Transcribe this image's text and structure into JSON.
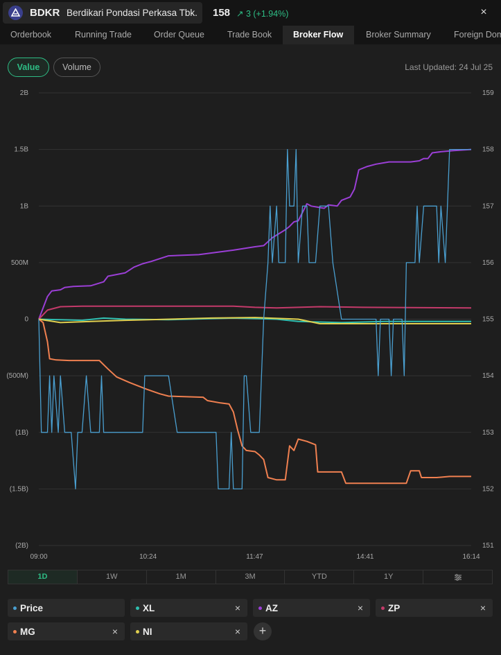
{
  "header": {
    "ticker": "BDKR",
    "company": "Berdikari Pondasi Perkasa Tbk.",
    "price": "158",
    "change": "3 (+1.94%)",
    "change_arrow": "↗",
    "close": "×"
  },
  "tabs": [
    "Orderbook",
    "Running Trade",
    "Order Queue",
    "Trade Book",
    "Broker Flow",
    "Broker Summary",
    "Foreign Dom"
  ],
  "active_tab": "Broker Flow",
  "toggles": {
    "value": "Value",
    "volume": "Volume"
  },
  "last_updated": "Last Updated: 24 Jul 25",
  "periods": [
    "1D",
    "1W",
    "1M",
    "3M",
    "YTD",
    "1Y"
  ],
  "active_period": "1D",
  "legend": {
    "price": "Price",
    "xl": "XL",
    "az": "AZ",
    "zp": "ZP",
    "mg": "MG",
    "ni": "NI",
    "remove": "×",
    "add": "+"
  },
  "colors": {
    "price": "#4a9fd0",
    "xl": "#2fbfb0",
    "az": "#9b3fd6",
    "zp": "#c43a6a",
    "mg": "#f08050",
    "ni": "#e0d050",
    "accent": "#2ebd85"
  },
  "icons": [
    "logo-icon",
    "close-icon",
    "arrow-up-right-icon",
    "filter-settings-icon",
    "plus-icon"
  ],
  "chart_data": {
    "type": "line",
    "x_ticks": [
      "09:00",
      "10:24",
      "11:47",
      "14:41",
      "16:14"
    ],
    "y_left_ticks": [
      "2B",
      "1.5B",
      "1B",
      "500M",
      "0",
      "(500M)",
      "(1B)",
      "(1.5B)",
      "(2B)"
    ],
    "y_right_ticks": [
      "159",
      "158",
      "157",
      "156",
      "155",
      "154",
      "153",
      "152",
      "151"
    ],
    "ylim_left": [
      -2000000000,
      2000000000
    ],
    "ylim_right": [
      151,
      159
    ],
    "grid": true,
    "series": [
      {
        "name": "AZ",
        "axis": "left",
        "color": "#9b3fd6",
        "points": [
          [
            0,
            0
          ],
          [
            0.02,
            200000000
          ],
          [
            0.03,
            250000000
          ],
          [
            0.05,
            260000000
          ],
          [
            0.06,
            280000000
          ],
          [
            0.08,
            290000000
          ],
          [
            0.12,
            295000000
          ],
          [
            0.15,
            330000000
          ],
          [
            0.16,
            380000000
          ],
          [
            0.2,
            410000000
          ],
          [
            0.22,
            460000000
          ],
          [
            0.24,
            490000000
          ],
          [
            0.26,
            510000000
          ],
          [
            0.3,
            560000000
          ],
          [
            0.37,
            570000000
          ],
          [
            0.45,
            610000000
          ],
          [
            0.5,
            640000000
          ],
          [
            0.52,
            650000000
          ],
          [
            0.54,
            720000000
          ],
          [
            0.57,
            790000000
          ],
          [
            0.58,
            820000000
          ],
          [
            0.59,
            860000000
          ],
          [
            0.6,
            870000000
          ],
          [
            0.62,
            1020000000
          ],
          [
            0.63,
            1000000000
          ],
          [
            0.66,
            980000000
          ],
          [
            0.67,
            1010000000
          ],
          [
            0.69,
            1000000000
          ],
          [
            0.7,
            1050000000
          ],
          [
            0.72,
            1080000000
          ],
          [
            0.73,
            1150000000
          ],
          [
            0.74,
            1320000000
          ],
          [
            0.76,
            1350000000
          ],
          [
            0.78,
            1370000000
          ],
          [
            0.81,
            1390000000
          ],
          [
            0.86,
            1390000000
          ],
          [
            0.88,
            1400000000
          ],
          [
            0.89,
            1420000000
          ],
          [
            0.9,
            1420000000
          ],
          [
            0.91,
            1470000000
          ],
          [
            0.93,
            1480000000
          ],
          [
            0.96,
            1490000000
          ],
          [
            1,
            1500000000
          ]
        ]
      },
      {
        "name": "MG",
        "axis": "left",
        "color": "#f08050",
        "points": [
          [
            0,
            0
          ],
          [
            0.01,
            -30000000
          ],
          [
            0.02,
            -200000000
          ],
          [
            0.025,
            -350000000
          ],
          [
            0.04,
            -360000000
          ],
          [
            0.07,
            -365000000
          ],
          [
            0.14,
            -365000000
          ],
          [
            0.16,
            -440000000
          ],
          [
            0.18,
            -510000000
          ],
          [
            0.21,
            -560000000
          ],
          [
            0.23,
            -590000000
          ],
          [
            0.25,
            -620000000
          ],
          [
            0.28,
            -660000000
          ],
          [
            0.3,
            -680000000
          ],
          [
            0.38,
            -690000000
          ],
          [
            0.39,
            -720000000
          ],
          [
            0.42,
            -740000000
          ],
          [
            0.44,
            -750000000
          ],
          [
            0.45,
            -820000000
          ],
          [
            0.46,
            -980000000
          ],
          [
            0.47,
            -1120000000
          ],
          [
            0.48,
            -1160000000
          ],
          [
            0.5,
            -1170000000
          ],
          [
            0.51,
            -1200000000
          ],
          [
            0.52,
            -1240000000
          ],
          [
            0.53,
            -1400000000
          ],
          [
            0.55,
            -1420000000
          ],
          [
            0.57,
            -1420000000
          ],
          [
            0.58,
            -1120000000
          ],
          [
            0.59,
            -1160000000
          ],
          [
            0.6,
            -1060000000
          ],
          [
            0.62,
            -1080000000
          ],
          [
            0.64,
            -1110000000
          ],
          [
            0.645,
            -1350000000
          ],
          [
            0.7,
            -1350000000
          ],
          [
            0.71,
            -1450000000
          ],
          [
            0.8,
            -1450000000
          ],
          [
            0.85,
            -1450000000
          ],
          [
            0.86,
            -1340000000
          ],
          [
            0.88,
            -1340000000
          ],
          [
            0.885,
            -1400000000
          ],
          [
            0.92,
            -1400000000
          ],
          [
            0.95,
            -1390000000
          ],
          [
            1,
            -1390000000
          ]
        ]
      },
      {
        "name": "ZP",
        "axis": "left",
        "color": "#c43a6a",
        "points": [
          [
            0,
            0
          ],
          [
            0.02,
            80000000
          ],
          [
            0.05,
            110000000
          ],
          [
            0.1,
            115000000
          ],
          [
            0.45,
            115000000
          ],
          [
            0.5,
            105000000
          ],
          [
            0.55,
            100000000
          ],
          [
            0.65,
            110000000
          ],
          [
            0.75,
            105000000
          ],
          [
            1,
            100000000
          ]
        ]
      },
      {
        "name": "XL",
        "axis": "left",
        "color": "#2fbfb0",
        "points": [
          [
            0,
            0
          ],
          [
            0.1,
            -10000000
          ],
          [
            0.15,
            10000000
          ],
          [
            0.2,
            0
          ],
          [
            0.3,
            -5000000
          ],
          [
            0.45,
            10000000
          ],
          [
            0.55,
            0
          ],
          [
            0.6,
            -20000000
          ],
          [
            0.7,
            -30000000
          ],
          [
            0.8,
            -20000000
          ],
          [
            0.9,
            -20000000
          ],
          [
            1,
            -20000000
          ]
        ]
      },
      {
        "name": "NI",
        "axis": "left",
        "color": "#e0d050",
        "points": [
          [
            0,
            0
          ],
          [
            0.05,
            -30000000
          ],
          [
            0.12,
            -20000000
          ],
          [
            0.2,
            -10000000
          ],
          [
            0.4,
            10000000
          ],
          [
            0.5,
            15000000
          ],
          [
            0.6,
            0
          ],
          [
            0.65,
            -40000000
          ],
          [
            0.75,
            -40000000
          ],
          [
            1,
            -40000000
          ]
        ]
      },
      {
        "name": "Price",
        "axis": "right",
        "color": "#4a9fd0",
        "points": [
          [
            0,
            155
          ],
          [
            0.006,
            153
          ],
          [
            0.02,
            153
          ],
          [
            0.025,
            154
          ],
          [
            0.03,
            153
          ],
          [
            0.035,
            154
          ],
          [
            0.045,
            153
          ],
          [
            0.05,
            154
          ],
          [
            0.06,
            153
          ],
          [
            0.075,
            153
          ],
          [
            0.085,
            152
          ],
          [
            0.09,
            153
          ],
          [
            0.1,
            153
          ],
          [
            0.11,
            154
          ],
          [
            0.12,
            153
          ],
          [
            0.14,
            153
          ],
          [
            0.145,
            154
          ],
          [
            0.15,
            153
          ],
          [
            0.24,
            153
          ],
          [
            0.245,
            154
          ],
          [
            0.3,
            154
          ],
          [
            0.32,
            153
          ],
          [
            0.41,
            153
          ],
          [
            0.415,
            152
          ],
          [
            0.44,
            152
          ],
          [
            0.445,
            153
          ],
          [
            0.45,
            152
          ],
          [
            0.47,
            152
          ],
          [
            0.475,
            154
          ],
          [
            0.48,
            154
          ],
          [
            0.49,
            153
          ],
          [
            0.51,
            153
          ],
          [
            0.52,
            155
          ],
          [
            0.53,
            156
          ],
          [
            0.535,
            157
          ],
          [
            0.54,
            156
          ],
          [
            0.55,
            157
          ],
          [
            0.555,
            156
          ],
          [
            0.57,
            156
          ],
          [
            0.575,
            158
          ],
          [
            0.58,
            157
          ],
          [
            0.59,
            157
          ],
          [
            0.595,
            158
          ],
          [
            0.6,
            156
          ],
          [
            0.61,
            157
          ],
          [
            0.62,
            157
          ],
          [
            0.625,
            156
          ],
          [
            0.64,
            156
          ],
          [
            0.65,
            157
          ],
          [
            0.66,
            157
          ],
          [
            0.67,
            157
          ],
          [
            0.68,
            156
          ],
          [
            0.7,
            155
          ],
          [
            0.78,
            155
          ],
          [
            0.785,
            154
          ],
          [
            0.79,
            155
          ],
          [
            0.81,
            155
          ],
          [
            0.815,
            154
          ],
          [
            0.82,
            155
          ],
          [
            0.84,
            155
          ],
          [
            0.845,
            154
          ],
          [
            0.85,
            156
          ],
          [
            0.87,
            156
          ],
          [
            0.875,
            157
          ],
          [
            0.88,
            156
          ],
          [
            0.89,
            157
          ],
          [
            0.92,
            157
          ],
          [
            0.925,
            156
          ],
          [
            0.93,
            157
          ],
          [
            0.94,
            156
          ],
          [
            0.95,
            158
          ],
          [
            1,
            158
          ]
        ]
      }
    ]
  }
}
